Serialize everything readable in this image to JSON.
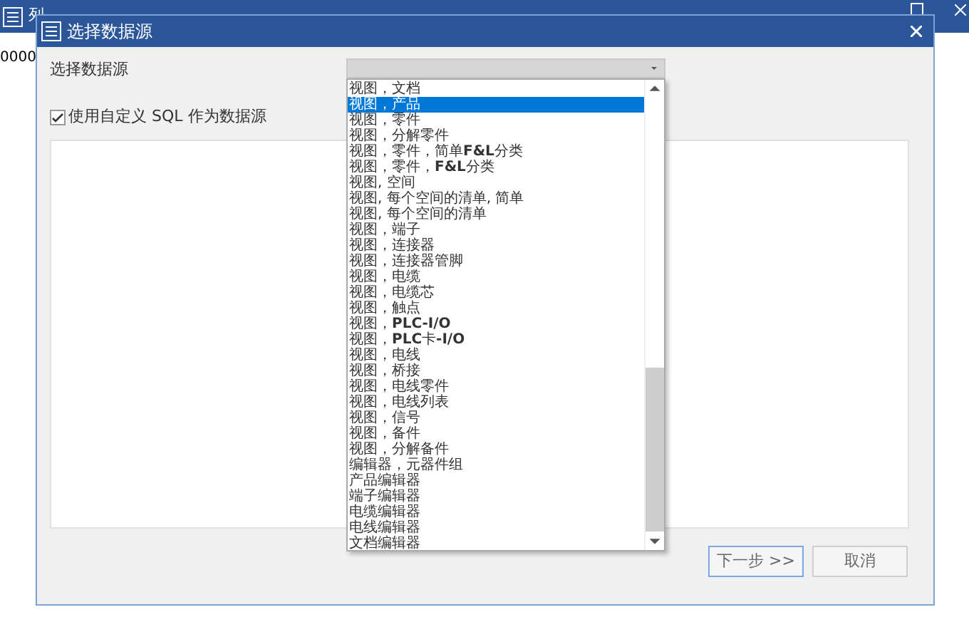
{
  "background_window": {
    "title": "列",
    "column_text": "0000"
  },
  "dialog": {
    "title": "选择数据源",
    "source_label": "选择数据源",
    "custom_sql": {
      "label": "使用自定义 SQL 作为数据源",
      "checked": true
    },
    "dropdown_items": [
      {
        "label": "视图，文档",
        "selected": false
      },
      {
        "label": "视图，产品",
        "selected": true
      },
      {
        "label": "视图，零件",
        "selected": false
      },
      {
        "label": "视图，分解零件",
        "selected": false
      },
      {
        "label": "视图，零件，简单**F&L**分类",
        "selected": false
      },
      {
        "label": "视图，零件，**F&L**分类",
        "selected": false
      },
      {
        "label": "视图, 空间",
        "selected": false
      },
      {
        "label": "视图, 每个空间的清单, 简单",
        "selected": false
      },
      {
        "label": "视图, 每个空间的清单",
        "selected": false
      },
      {
        "label": "视图，端子",
        "selected": false
      },
      {
        "label": "视图，连接器",
        "selected": false
      },
      {
        "label": "视图，连接器管脚",
        "selected": false
      },
      {
        "label": "视图，电缆",
        "selected": false
      },
      {
        "label": "视图，电缆芯",
        "selected": false
      },
      {
        "label": "视图，触点",
        "selected": false
      },
      {
        "label": "视图，**PLC-I/O**",
        "selected": false
      },
      {
        "label": "视图，**PLC**卡**-I/O**",
        "selected": false
      },
      {
        "label": "视图，电线",
        "selected": false
      },
      {
        "label": "视图，桥接",
        "selected": false
      },
      {
        "label": "视图，电线零件",
        "selected": false
      },
      {
        "label": "视图，电线列表",
        "selected": false
      },
      {
        "label": "视图，信号",
        "selected": false
      },
      {
        "label": "视图，备件",
        "selected": false
      },
      {
        "label": "视图，分解备件",
        "selected": false
      },
      {
        "label": "编辑器，元器件组",
        "selected": false
      },
      {
        "label": "产品编辑器",
        "selected": false
      },
      {
        "label": "端子编辑器",
        "selected": false
      },
      {
        "label": "电缆编辑器",
        "selected": false
      },
      {
        "label": "电线编辑器",
        "selected": false
      },
      {
        "label": "文档编辑器",
        "selected": false
      }
    ],
    "buttons": [
      {
        "label": "下一步 >>",
        "kind": "default"
      },
      {
        "label": "取消",
        "kind": "normal"
      }
    ]
  }
}
